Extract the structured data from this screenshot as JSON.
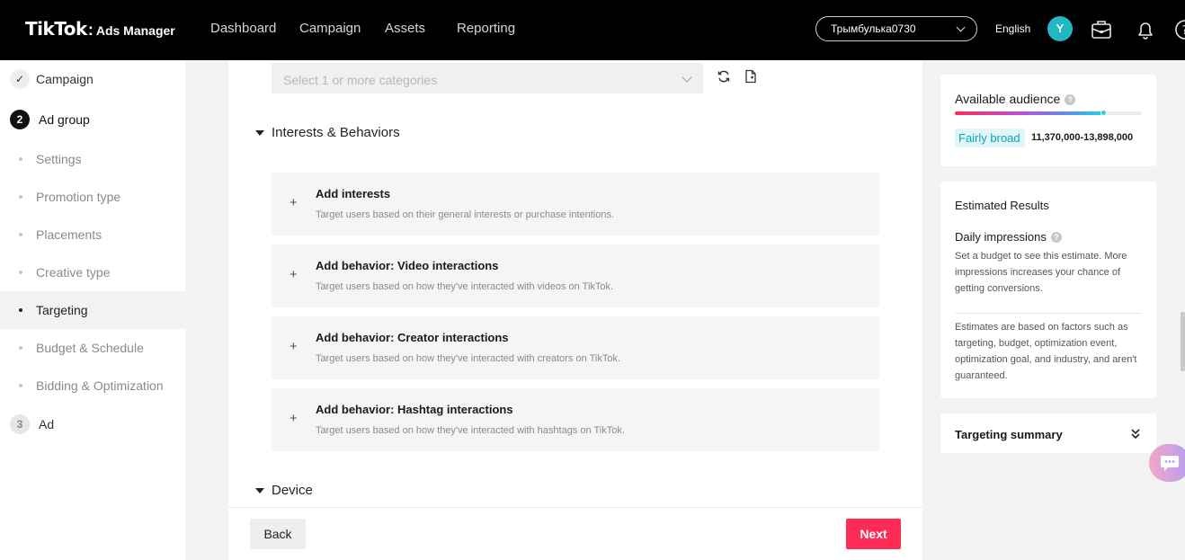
{
  "header": {
    "logo_main": "TikTok",
    "logo_colon": ":",
    "logo_sub": "Ads Manager",
    "nav": [
      "Dashboard",
      "Campaign",
      "Assets",
      "Reporting"
    ],
    "account_name": "Трымбулька0730",
    "language": "English",
    "avatar_initial": "Y",
    "icons": [
      "briefcase-icon",
      "bell-icon",
      "help-icon"
    ]
  },
  "sidebar": {
    "steps": [
      {
        "badge": "✓",
        "label": "Campaign",
        "state": "done"
      },
      {
        "badge": "2",
        "label": "Ad group",
        "state": "current"
      },
      {
        "badge": "3",
        "label": "Ad",
        "state": "pending"
      }
    ],
    "substeps": [
      "Settings",
      "Promotion type",
      "Placements",
      "Creative type",
      "Targeting",
      "Budget & Schedule",
      "Bidding & Optimization"
    ],
    "active_substep": "Targeting"
  },
  "main": {
    "category_placeholder": "Select 1 or more categories",
    "interests_section": "Interests & Behaviors",
    "cards": [
      {
        "title": "Add interests",
        "desc": "Target users based on their general interests or purchase intentions."
      },
      {
        "title": "Add behavior: Video interactions",
        "desc": "Target users based on how they've interacted with videos on TikTok."
      },
      {
        "title": "Add behavior: Creator interactions",
        "desc": "Target users based on how they've interacted with creators on TikTok."
      },
      {
        "title": "Add behavior: Hashtag interactions",
        "desc": "Target users based on how they've interacted with hashtags on TikTok."
      }
    ],
    "plus_symbol": "+",
    "device_section": "Device",
    "back_label": "Back",
    "next_label": "Next"
  },
  "right": {
    "audience_title": "Available audience",
    "audience_level": 0.8,
    "audience_tag": "Fairly broad",
    "audience_range": "11,370,000-13,898,000",
    "help_glyph": "?",
    "estimated_title": "Estimated Results",
    "daily_title": "Daily impressions",
    "daily_text": "Set a budget to see this estimate. More impressions increases your chance of getting conversions.",
    "disclaimer": "Estimates are based on factors such as targeting, budget, optimization event, optimization goal, and industry, and aren't guaranteed.",
    "summary_title": "Targeting summary"
  },
  "colors": {
    "brand_pink": "#fe2c55",
    "accent_cyan": "#25d0df"
  }
}
